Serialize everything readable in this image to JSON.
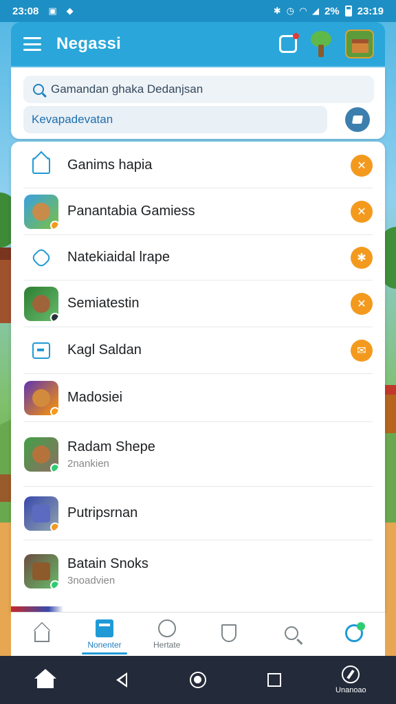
{
  "status_bar": {
    "time": "23:08",
    "battery": "2%",
    "right_time": "23:19"
  },
  "app_bar": {
    "title": "Negassi",
    "menu_icon": "hamburger-icon",
    "notification_icon": "notification-icon",
    "tree_icon": "tree-icon",
    "game_thumb_icon": "game-thumbnail"
  },
  "search": {
    "placeholder": "Gamandan ghaka Dedanjsan",
    "filter_text": "Kevapadevatan",
    "filter_button_icon": "edit-icon"
  },
  "list": {
    "items": [
      {
        "title": "Ganims hapia",
        "subtitle": "",
        "leading_icon": "mail-icon",
        "trailing_icon": "close-badge-icon"
      },
      {
        "title": "Panantabia Gamiess",
        "subtitle": "",
        "leading_icon": "game-icon",
        "trailing_icon": "close-badge-icon"
      },
      {
        "title": "Natekiaidal lrape",
        "subtitle": "",
        "leading_icon": "hexagon-icon",
        "trailing_icon": "tools-badge-icon"
      },
      {
        "title": "Semiatestin",
        "subtitle": "",
        "leading_icon": "game-icon",
        "trailing_icon": "close-badge-icon"
      },
      {
        "title": "Kagl Saldan",
        "subtitle": "",
        "leading_icon": "message-icon",
        "trailing_icon": "mail-badge-icon"
      },
      {
        "title": "Madosiei",
        "subtitle": "",
        "leading_icon": "game-icon",
        "trailing_icon": ""
      },
      {
        "title": "Radam Shepe",
        "subtitle": "2nankien",
        "leading_icon": "game-icon",
        "trailing_icon": ""
      },
      {
        "title": "Putripsrnan",
        "subtitle": "",
        "leading_icon": "game-icon",
        "trailing_icon": ""
      },
      {
        "title": "Batain Snoks",
        "subtitle": "3noadvien",
        "leading_icon": "game-icon",
        "trailing_icon": ""
      }
    ]
  },
  "bottom_nav": {
    "tabs": [
      {
        "label": "",
        "icon": "home-icon",
        "active": false
      },
      {
        "label": "Nonenter",
        "icon": "news-icon",
        "active": true
      },
      {
        "label": "Hertate",
        "icon": "activity-icon",
        "active": false
      },
      {
        "label": "",
        "icon": "shield-icon",
        "active": false
      },
      {
        "label": "",
        "icon": "search-icon",
        "active": false
      },
      {
        "label": "",
        "icon": "refresh-icon",
        "active": false
      }
    ]
  },
  "system_nav": {
    "compass_label": "Unanoao"
  },
  "colors": {
    "primary": "#2aa6da",
    "accent": "#f39a1e",
    "status_bar": "#1d8fc4",
    "system_nav": "#232a3a"
  }
}
